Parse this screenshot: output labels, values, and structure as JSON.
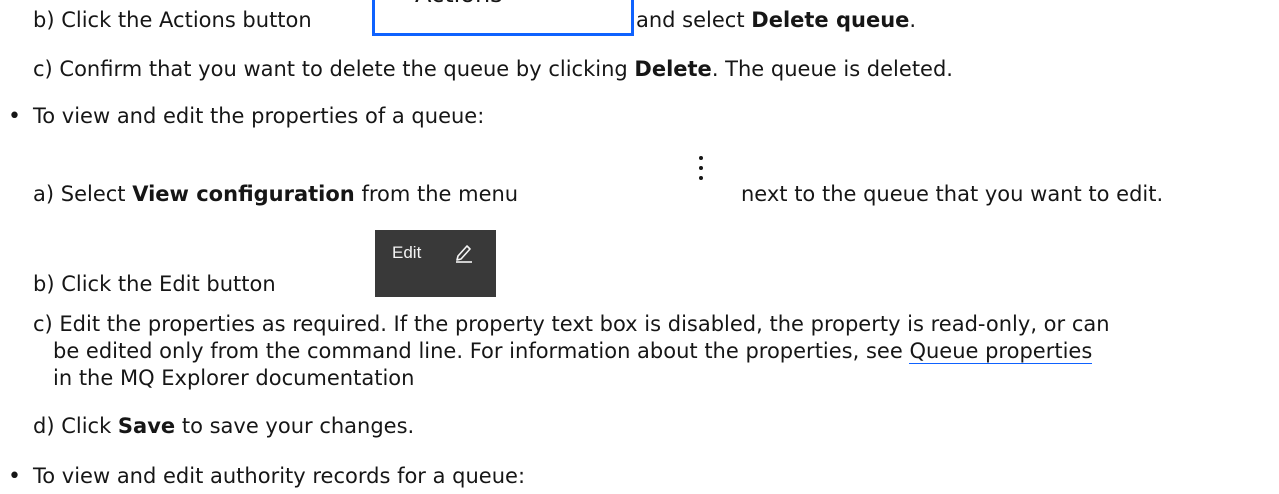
{
  "steps": {
    "b_actions": {
      "prefix": "b) Click the Actions button",
      "middle": "and select ",
      "bold": "Delete queue",
      "suffix": "."
    },
    "actions_button": {
      "label": "Actions",
      "icon": "chevron-down-icon"
    },
    "c_delete": {
      "prefix": "c) Confirm that you want to delete the queue by clicking ",
      "bold": "Delete",
      "suffix": ". The queue is deleted."
    }
  },
  "bullet_view_edit": {
    "bullet": "•",
    "text": "To view and edit the properties of a queue:",
    "step_a": {
      "prefix": "a) Select ",
      "bold": "View configuration",
      "middle": " from the menu",
      "suffix": "next to the queue that you want to edit.",
      "icon": "overflow-menu-vertical-icon"
    },
    "step_b": {
      "text": "b) Click the Edit button"
    },
    "edit_button": {
      "label": "Edit",
      "icon": "edit-pencil-icon"
    },
    "step_c": {
      "line1": "c) Edit the properties as required. If the property text box is disabled, the property is read-only, or can",
      "line2_prefix": "be edited only from the command line. For information about the properties, see ",
      "link": "Queue properties",
      "line3": "in the MQ Explorer documentation"
    },
    "step_d": {
      "prefix": "d) Click ",
      "bold": "Save",
      "suffix": " to save your changes."
    }
  },
  "bullet_authority": {
    "bullet": "•",
    "text": "To view and edit authority records for a queue:"
  },
  "colors": {
    "text": "#161616",
    "accent_blue": "#0f62fe",
    "edit_button_bg": "#393939",
    "edit_button_text": "#f4f4f4"
  }
}
